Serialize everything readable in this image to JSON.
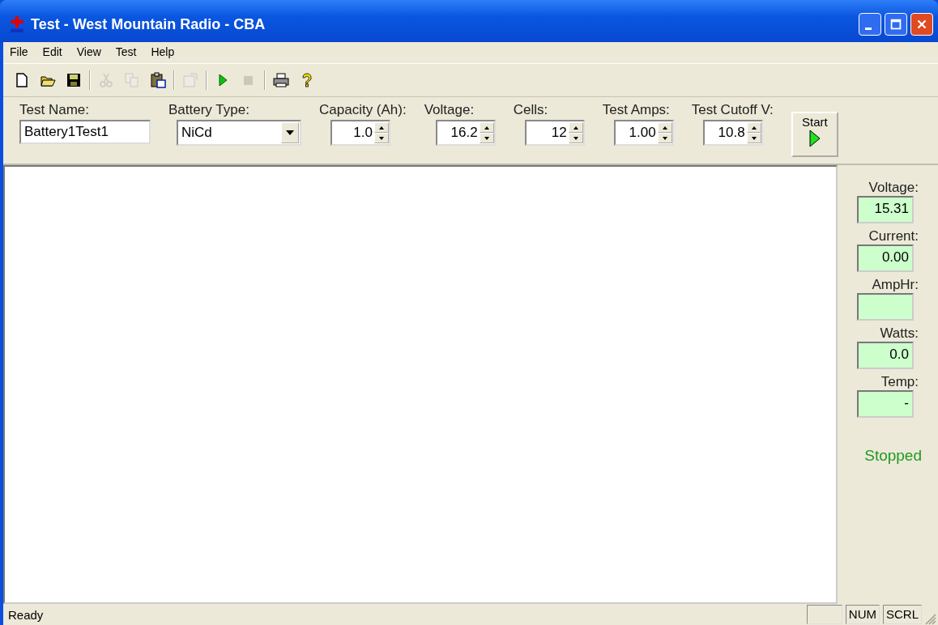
{
  "window": {
    "title": "Test - West Mountain Radio - CBA"
  },
  "menu": [
    "File",
    "Edit",
    "View",
    "Test",
    "Help"
  ],
  "toolbar": [
    {
      "kind": "new",
      "disabled": false
    },
    {
      "kind": "open",
      "disabled": false
    },
    {
      "kind": "save",
      "disabled": false
    },
    {
      "kind": "sep"
    },
    {
      "kind": "cut",
      "disabled": true
    },
    {
      "kind": "copy",
      "disabled": true
    },
    {
      "kind": "paste",
      "disabled": false
    },
    {
      "kind": "sep"
    },
    {
      "kind": "properties",
      "disabled": true
    },
    {
      "kind": "sep"
    },
    {
      "kind": "play",
      "disabled": false
    },
    {
      "kind": "stop",
      "disabled": true
    },
    {
      "kind": "sep"
    },
    {
      "kind": "print",
      "disabled": false
    },
    {
      "kind": "help",
      "disabled": false
    }
  ],
  "params": [
    {
      "label": "Test Name:",
      "value": "Battery1Test1",
      "kind": "text"
    },
    {
      "label": "Battery Type:",
      "value": "NiCd",
      "kind": "combo"
    },
    {
      "label": "Capacity (Ah):",
      "value": "1.0",
      "kind": "spin"
    },
    {
      "label": "Voltage:",
      "value": "16.2",
      "kind": "spin"
    },
    {
      "label": "Cells:",
      "value": "12",
      "kind": "spin"
    },
    {
      "label": "Test Amps:",
      "value": "1.00",
      "kind": "spin"
    },
    {
      "label": "Test Cutoff V:",
      "value": "10.8",
      "kind": "spin"
    }
  ],
  "start_button": {
    "label": "Start"
  },
  "readouts": [
    {
      "label": "Voltage:",
      "value": "15.31"
    },
    {
      "label": "Current:",
      "value": "0.00"
    },
    {
      "label": "AmpHr:"
    },
    {
      "label": "Watts:",
      "value": "0.0"
    },
    {
      "label": "Temp:",
      "value": "-"
    }
  ],
  "run_state": {
    "text": "Stopped",
    "color": "#1f9a1f"
  },
  "status_bar": {
    "message": "Ready",
    "panels": [
      "NUM",
      "SCRL"
    ]
  }
}
